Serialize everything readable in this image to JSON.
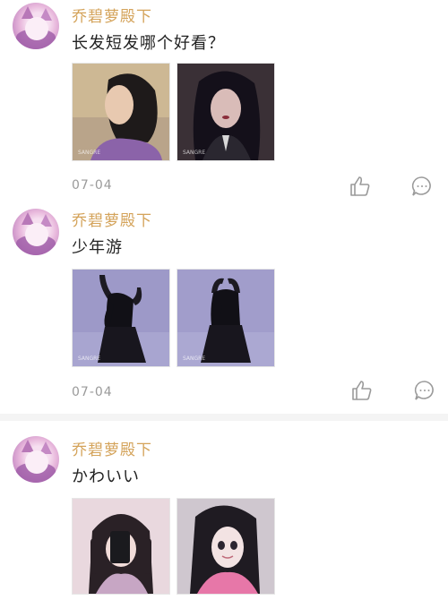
{
  "posts": [
    {
      "username": "乔碧萝殿下",
      "text": "长发短发哪个好看？",
      "date": "07-04",
      "images": [
        "short-hair-purple-sweater",
        "long-hair-dark-uniform"
      ]
    },
    {
      "username": "乔碧萝殿下",
      "text": "少年游",
      "date": "07-04",
      "images": [
        "silhouette-dancer-left",
        "silhouette-dancer-right"
      ]
    },
    {
      "username": "乔碧萝殿下",
      "text": "かわいい",
      "images": [
        "braids-phone-selfie",
        "anime-style-girl"
      ]
    }
  ],
  "icons": {
    "like": "thumbs-up-icon",
    "comment": "comment-bubble-icon"
  },
  "colors": {
    "username": "#d4a35a",
    "date": "#9a9a9a",
    "icon": "#9a9a9a",
    "divider": "#f4f4f4"
  }
}
